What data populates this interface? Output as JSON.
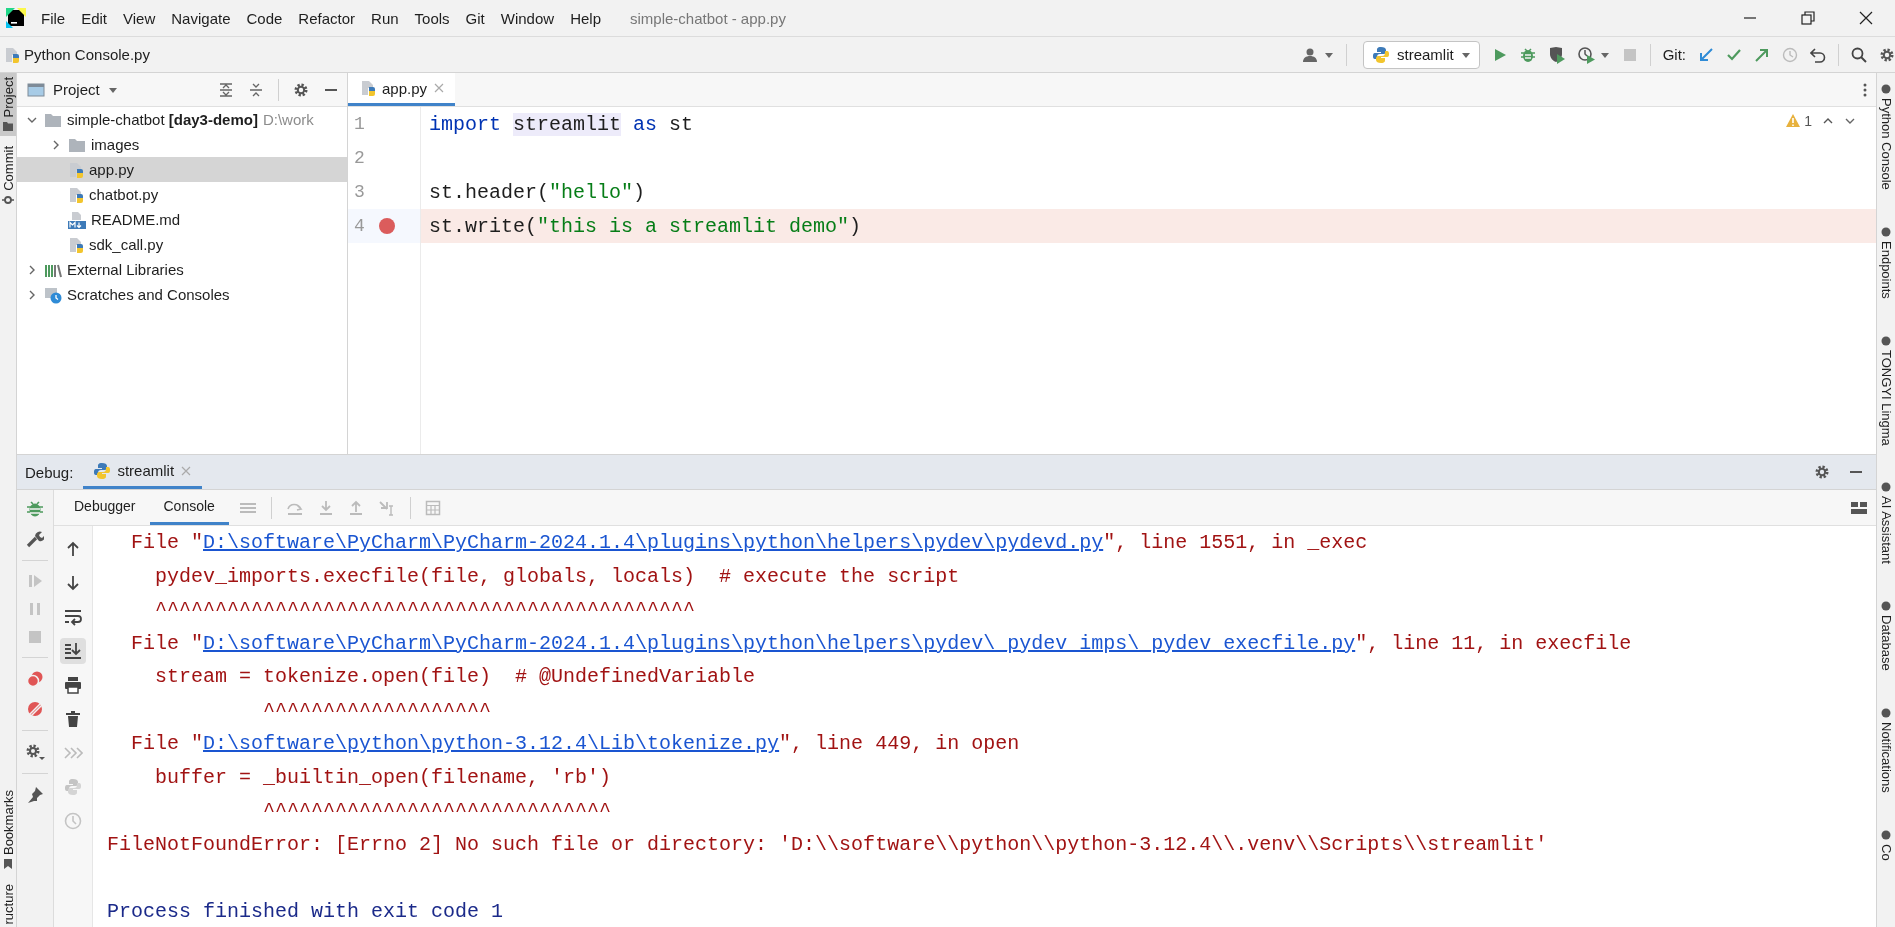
{
  "title_bar": {
    "menu": [
      "File",
      "Edit",
      "View",
      "Navigate",
      "Code",
      "Refactor",
      "Run",
      "Tools",
      "Git",
      "Window",
      "Help"
    ],
    "title": "simple-chatbot - app.py"
  },
  "nav_bar": {
    "breadcrumb": "Python Console.py",
    "run_config": "streamlit",
    "git_label": "Git:"
  },
  "left_tool_strip": {
    "top": [
      {
        "label": "Project",
        "selected": true
      },
      {
        "label": "Commit",
        "selected": false
      }
    ],
    "bottom": [
      {
        "label": "Bookmarks",
        "selected": false
      },
      {
        "label": "ructure",
        "selected": false
      }
    ]
  },
  "project_panel": {
    "title": "Project",
    "tree": [
      {
        "kind": "folder",
        "label": "simple-chatbot **[day3-demo]**",
        "hint": "D:\\work",
        "expanded": true,
        "selected": false,
        "children": [
          {
            "kind": "folder",
            "label": "images",
            "expanded": false,
            "selected": false
          },
          {
            "kind": "python",
            "label": "app.py",
            "selected": true
          },
          {
            "kind": "python",
            "label": "chatbot.py",
            "selected": false
          },
          {
            "kind": "markdown",
            "label": "README.md",
            "selected": false
          },
          {
            "kind": "python",
            "label": "sdk_call.py",
            "selected": false
          }
        ]
      },
      {
        "kind": "library",
        "label": "External Libraries",
        "expanded": false,
        "selected": false
      },
      {
        "kind": "scratches",
        "label": "Scratches and Consoles",
        "expanded": false,
        "selected": false
      }
    ]
  },
  "editor": {
    "tabs": [
      {
        "label": "app.py",
        "selected": true
      }
    ],
    "warning_count": "1",
    "lines": [
      {
        "number": "1",
        "breakpoint": false,
        "tokens": [
          {
            "text": "import ",
            "kind": "keyword"
          },
          {
            "text": "streamlit",
            "kind": "usage"
          },
          {
            "text": " as",
            "kind": "keyword"
          },
          {
            "text": " st",
            "kind": "plain"
          }
        ]
      },
      {
        "number": "2",
        "breakpoint": false
      },
      {
        "number": "3",
        "breakpoint": false,
        "tokens": [
          {
            "text": "st.header(",
            "kind": "plain"
          },
          {
            "text": "\"hello\"",
            "kind": "string"
          },
          {
            "text": ")",
            "kind": "plain"
          }
        ]
      },
      {
        "number": "4",
        "breakpoint": true,
        "tokens": [
          {
            "text": "st.write(",
            "kind": "plain"
          },
          {
            "text": "\"this is a streamlit demo\"",
            "kind": "string"
          },
          {
            "text": ")",
            "kind": "plain"
          }
        ]
      }
    ]
  },
  "debug_panel": {
    "label": "Debug:",
    "tabs": [
      {
        "label": "streamlit",
        "selected": true
      }
    ],
    "subtabs": [
      {
        "label": "Debugger",
        "selected": false
      },
      {
        "label": "Console",
        "selected": true
      }
    ],
    "console": [
      {
        "kind": "trace",
        "segments": [
          {
            "text": "  File \"",
            "link": false
          },
          {
            "text": "D:\\software\\PyCharm\\PyCharm-2024.1.4\\plugins\\python\\helpers\\pydev\\pydevd.py",
            "link": true
          },
          {
            "text": "\", line 1551, in _exec",
            "link": false
          }
        ]
      },
      {
        "kind": "trace",
        "text": "    pydev_imports.execfile(file, globals, locals)  # execute the script"
      },
      {
        "kind": "trace",
        "text": "    ^^^^^^^^^^^^^^^^^^^^^^^^^^^^^^^^^^^^^^^^^^^^^"
      },
      {
        "kind": "trace",
        "segments": [
          {
            "text": "  File \"",
            "link": false
          },
          {
            "text": "D:\\software\\PyCharm\\PyCharm-2024.1.4\\plugins\\python\\helpers\\pydev\\_pydev_imps\\_pydev_execfile.py",
            "link": true
          },
          {
            "text": "\", line 11, in execfile",
            "link": false
          }
        ]
      },
      {
        "kind": "trace",
        "text": "    stream = tokenize.open(file)  # @UndefinedVariable"
      },
      {
        "kind": "trace",
        "text": "             ^^^^^^^^^^^^^^^^^^^"
      },
      {
        "kind": "trace",
        "segments": [
          {
            "text": "  File \"",
            "link": false
          },
          {
            "text": "D:\\software\\python\\python-3.12.4\\Lib\\tokenize.py",
            "link": true
          },
          {
            "text": "\", line 449, in open",
            "link": false
          }
        ]
      },
      {
        "kind": "trace",
        "text": "    buffer = _builtin_open(filename, 'rb')"
      },
      {
        "kind": "trace",
        "text": "             ^^^^^^^^^^^^^^^^^^^^^^^^^^^^^"
      },
      {
        "kind": "error",
        "text": "FileNotFoundError: [Errno 2] No such file or directory: 'D:\\\\software\\\\python\\\\python-3.12.4\\\\.venv\\\\Scripts\\\\streamlit'"
      },
      {
        "kind": "exit",
        "text": "Process finished with exit code 1"
      }
    ]
  },
  "right_tool_strip": [
    "Python Console",
    "Endpoints",
    "TONGYI Lingma",
    "AI Assistant",
    "Database",
    "Notifications",
    "Co"
  ]
}
